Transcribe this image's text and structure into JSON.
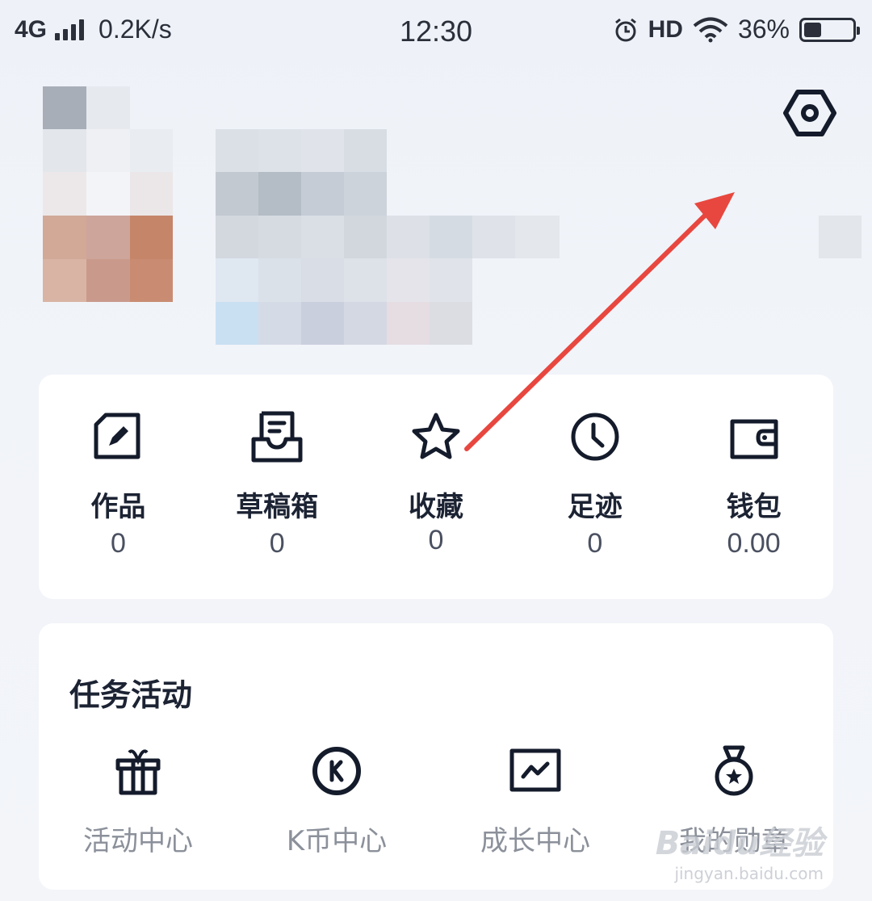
{
  "status_bar": {
    "network": "4G",
    "speed": "0.2K/s",
    "time": "12:30",
    "hd": "HD",
    "battery": "36%",
    "battery_level": 0.36
  },
  "profile": {
    "settings_icon": "settings-hexagon-icon"
  },
  "stats": [
    {
      "label": "作品",
      "value": "0",
      "icon": "edit-document-icon"
    },
    {
      "label": "草稿箱",
      "value": "0",
      "icon": "drafts-tray-icon"
    },
    {
      "label": "收藏",
      "value": "0",
      "icon": "star-icon"
    },
    {
      "label": "足迹",
      "value": "0",
      "icon": "clock-icon"
    },
    {
      "label": "钱包",
      "value": "0.00",
      "icon": "wallet-icon"
    }
  ],
  "tasks": {
    "title": "任务活动",
    "items": [
      {
        "label": "活动中心",
        "icon": "gift-icon"
      },
      {
        "label": "K币中心",
        "icon": "k-coin-icon"
      },
      {
        "label": "成长中心",
        "icon": "growth-chart-icon"
      },
      {
        "label": "我的勋章",
        "icon": "medal-icon"
      }
    ]
  },
  "annotation_color": "#e8473f",
  "watermark": {
    "logo": "Baidu经验",
    "url": "jingyan.baidu.com"
  }
}
